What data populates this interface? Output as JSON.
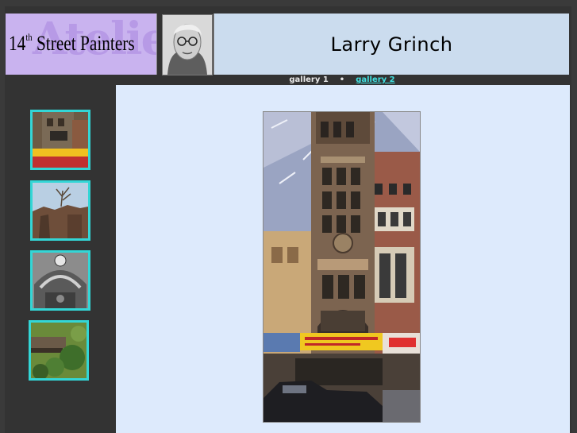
{
  "header": {
    "logo_watermark": "Atelier",
    "logo_number": "14",
    "logo_suffix": "th",
    "logo_text": " Street Painters",
    "artist_name": "Larry Grinch"
  },
  "nav": {
    "items": [
      {
        "label": "gallery 1",
        "current": true
      },
      {
        "label": "gallery 2",
        "current": false
      }
    ],
    "separator": "•"
  },
  "colors": {
    "header_bg": "#cbdcee",
    "logo_bg": "#c9b3ef",
    "page_bg": "#333333",
    "main_bg": "#ddeafc",
    "thumb_border": "#33d6d6",
    "link": "#40e0e0"
  },
  "icons": [
    "artist-portrait",
    "painting-thumbnail"
  ]
}
